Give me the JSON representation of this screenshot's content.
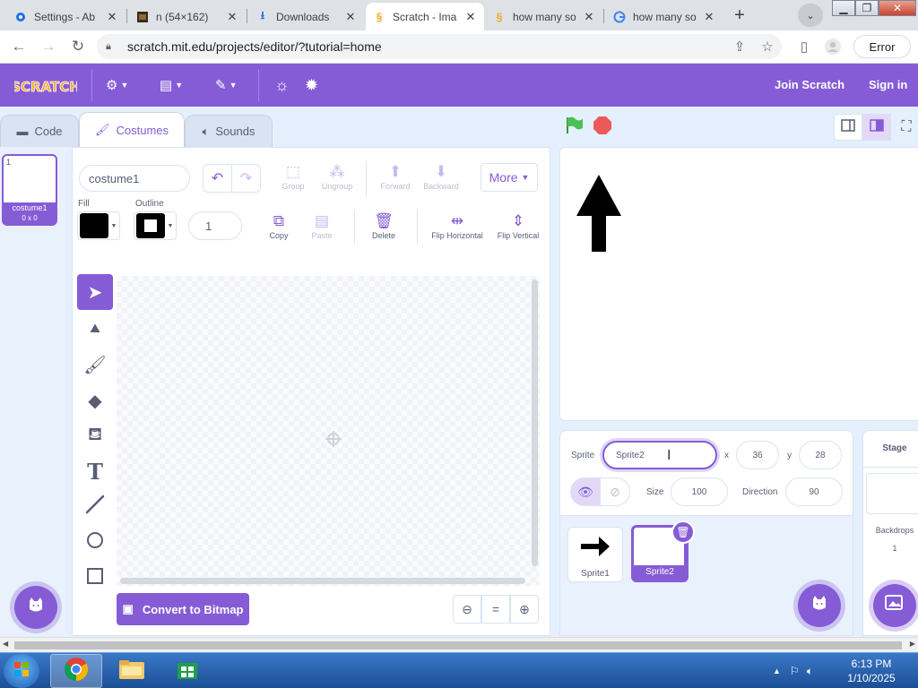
{
  "browser": {
    "tabs": [
      {
        "label": "Settings - Ab",
        "icon": "settings-icon"
      },
      {
        "label": "n (54×162)",
        "icon": "image-icon"
      },
      {
        "label": "Downloads",
        "icon": "download-icon"
      },
      {
        "label": "Scratch - Ima",
        "icon": "scratch-icon",
        "active": true
      },
      {
        "label": "how many so",
        "icon": "scratch-icon"
      },
      {
        "label": "how many so",
        "icon": "google-icon"
      }
    ],
    "url": "scratch.mit.edu/projects/editor/?tutorial=home",
    "error_label": "Error"
  },
  "menubar": {
    "logo_text": "SCRATCH",
    "join_label": "Join Scratch",
    "signin_label": "Sign in"
  },
  "editor_tabs": {
    "code": "Code",
    "costumes": "Costumes",
    "sounds": "Sounds"
  },
  "costume_list": {
    "items": [
      {
        "number": "1",
        "name": "costume1",
        "size": "0 x 0"
      }
    ]
  },
  "paint": {
    "costume_name": "costume1",
    "group": "Group",
    "ungroup": "Ungroup",
    "forward": "Forward",
    "backward": "Backward",
    "more": "More",
    "fill_label": "Fill",
    "outline_label": "Outline",
    "outline_width": "1",
    "copy": "Copy",
    "paste": "Paste",
    "delete": "Delete",
    "flip_horizontal": "Flip Horizontal",
    "flip_vertical": "Flip Vertical",
    "convert_label": "Convert to Bitmap",
    "fill_color": "#000000",
    "outline_color": "#000000"
  },
  "sprite_info": {
    "sprite_label": "Sprite",
    "sprite_name": "Sprite2",
    "x_label": "x",
    "x_value": "36",
    "y_label": "y",
    "y_value": "28",
    "show_label": "Show",
    "size_label": "Size",
    "size_value": "100",
    "direction_label": "Direction",
    "direction_value": "90"
  },
  "sprites": [
    {
      "name": "Sprite1"
    },
    {
      "name": "Sprite2",
      "selected": true
    }
  ],
  "stage_panel": {
    "title": "Stage",
    "backdrops_label": "Backdrops",
    "backdrops_count": "1"
  },
  "taskbar": {
    "time": "6:13 PM",
    "date": "1/10/2025"
  },
  "colors": {
    "accent": "#855cd6",
    "green_flag": "#4cbf56",
    "stop": "#ec5959"
  }
}
